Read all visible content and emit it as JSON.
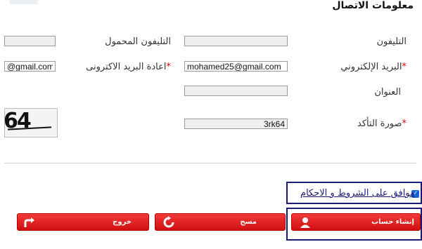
{
  "section": {
    "title": "معلومات الاتصال"
  },
  "fields": {
    "phone": {
      "label": "التليفون",
      "value": ""
    },
    "mobile": {
      "label": "التليفون المحمول",
      "value": ""
    },
    "email": {
      "label": "البريد الإلكتروني",
      "required_mark": "*",
      "value": "mohamed25@gmail.com"
    },
    "email_confirm": {
      "label": "اعادة البريد الاكترونى",
      "required_mark": "*",
      "value": "@gmail.com"
    },
    "address": {
      "label": "العنوان",
      "value": ""
    },
    "captcha": {
      "label": "صورة التأكد",
      "required_mark": "*",
      "value": "3rk64",
      "image_text": "64"
    }
  },
  "terms": {
    "label": "موافق على الشروط و الاحكام",
    "checked": true
  },
  "buttons": {
    "create": {
      "label": "إنشاء حساب",
      "icon": "user-icon"
    },
    "clear": {
      "label": "مسح",
      "icon": "refresh-icon"
    },
    "exit": {
      "label": "خروج",
      "icon": "exit-arrow-icon"
    }
  },
  "colors": {
    "button_red": "#e02020",
    "highlight_border": "#1a1a7a",
    "checkbox_blue": "#1565d8"
  }
}
